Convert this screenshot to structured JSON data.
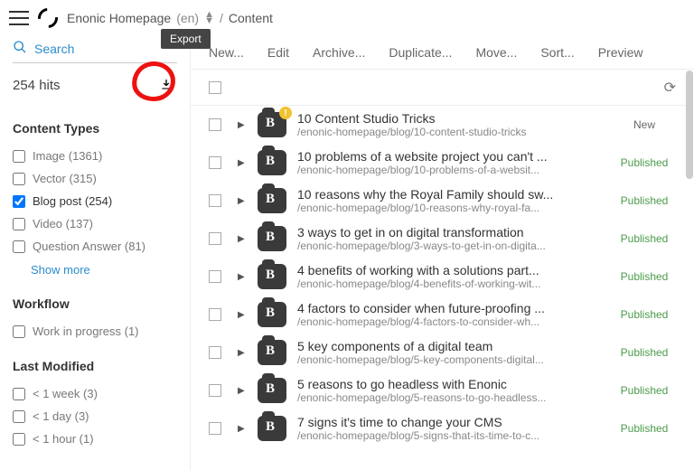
{
  "header": {
    "project_name": "Enonic Homepage",
    "project_lang": "(en)",
    "section": "Content"
  },
  "sidebar": {
    "search_placeholder": "Search",
    "hits_label": "254 hits",
    "export_tooltip": "Export",
    "facets": {
      "content_types": {
        "title": "Content Types",
        "items": [
          {
            "label": "Image (1361)",
            "checked": false
          },
          {
            "label": "Vector (315)",
            "checked": false
          },
          {
            "label": "Blog post (254)",
            "checked": true
          },
          {
            "label": "Video (137)",
            "checked": false
          },
          {
            "label": "Question Answer (81)",
            "checked": false
          }
        ],
        "show_more": "Show more"
      },
      "workflow": {
        "title": "Workflow",
        "items": [
          {
            "label": "Work in progress (1)",
            "checked": false
          }
        ]
      },
      "last_modified": {
        "title": "Last Modified",
        "items": [
          {
            "label": "< 1 week (3)",
            "checked": false
          },
          {
            "label": "< 1 day (3)",
            "checked": false
          },
          {
            "label": "< 1 hour (1)",
            "checked": false
          }
        ]
      }
    }
  },
  "toolbar": {
    "new": "New...",
    "edit": "Edit",
    "archive": "Archive...",
    "duplicate": "Duplicate...",
    "move": "Move...",
    "sort": "Sort...",
    "preview": "Preview"
  },
  "status_labels": {
    "new": "New",
    "published": "Published"
  },
  "rows": [
    {
      "title": "10 Content Studio Tricks",
      "path": "/enonic-homepage/blog/10-content-studio-tricks",
      "status": "new",
      "badge": true
    },
    {
      "title": "10 problems of a website project you can't ...",
      "path": "/enonic-homepage/blog/10-problems-of-a-websit...",
      "status": "published"
    },
    {
      "title": "10 reasons why the Royal Family should sw...",
      "path": "/enonic-homepage/blog/10-reasons-why-royal-fa...",
      "status": "published"
    },
    {
      "title": "3 ways to get in on digital transformation",
      "path": "/enonic-homepage/blog/3-ways-to-get-in-on-digita...",
      "status": "published"
    },
    {
      "title": "4 benefits of working with a solutions part...",
      "path": "/enonic-homepage/blog/4-benefits-of-working-wit...",
      "status": "published"
    },
    {
      "title": "4 factors to consider when future-proofing ...",
      "path": "/enonic-homepage/blog/4-factors-to-consider-wh...",
      "status": "published"
    },
    {
      "title": "5 key components of a digital team",
      "path": "/enonic-homepage/blog/5-key-components-digital...",
      "status": "published"
    },
    {
      "title": "5 reasons to go headless with Enonic",
      "path": "/enonic-homepage/blog/5-reasons-to-go-headless...",
      "status": "published"
    },
    {
      "title": "7 signs it's time to change your CMS",
      "path": "/enonic-homepage/blog/5-signs-that-its-time-to-c...",
      "status": "published"
    }
  ]
}
